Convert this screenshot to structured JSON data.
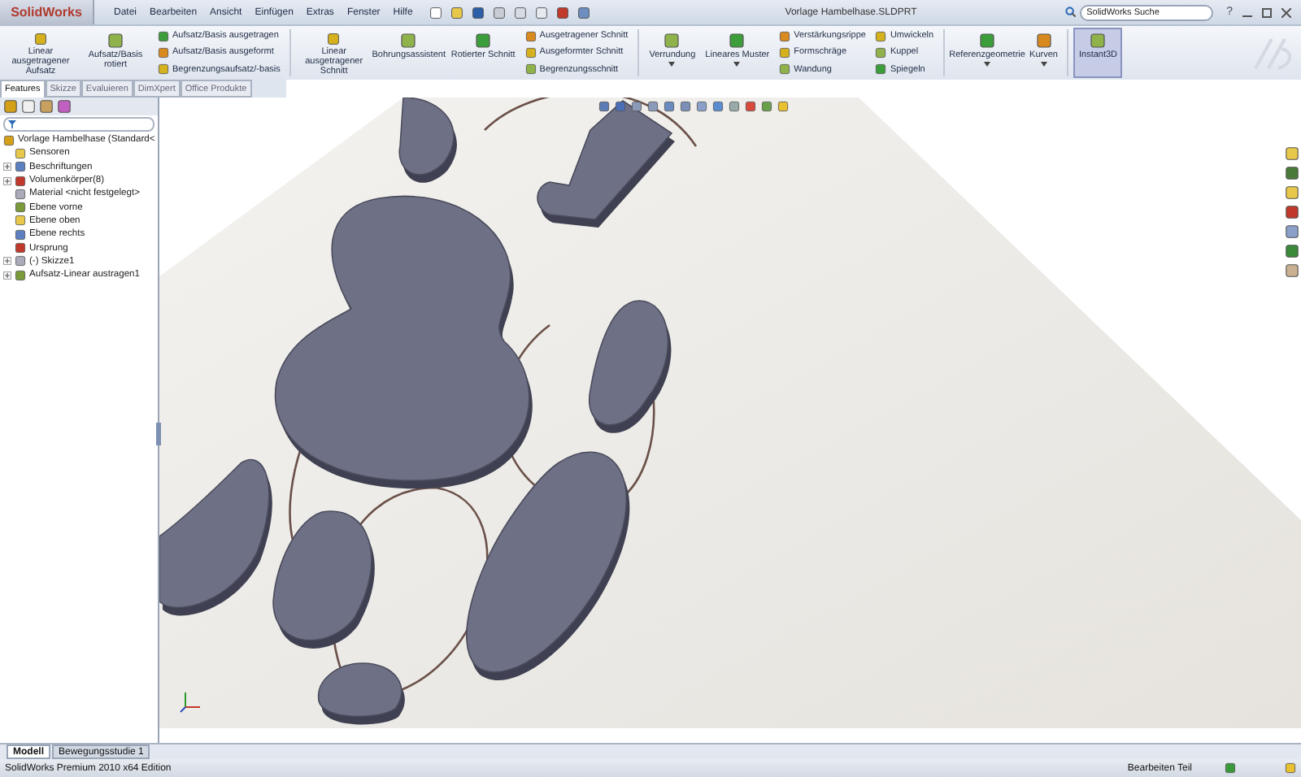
{
  "app": {
    "logo": "SolidWorks",
    "menu": [
      "Datei",
      "Bearbeiten",
      "Ansicht",
      "Einfügen",
      "Extras",
      "Fenster",
      "Hilfe"
    ],
    "document_title": "Vorlage Hambelhase.SLDPRT",
    "search": {
      "placeholder": "SolidWorks Suche"
    },
    "help": "?"
  },
  "ribbon": {
    "columns": [
      {
        "kind": "large",
        "label": "Linear ausgetragener Aufsatz",
        "dropdown": false,
        "selected": false
      },
      {
        "kind": "large",
        "label": "Aufsatz/Basis rotiert",
        "dropdown": false,
        "selected": false
      },
      {
        "kind": "stack",
        "items": [
          "Aufsatz/Basis ausgetragen",
          "Aufsatz/Basis ausgeformt",
          "Begrenzungsaufsatz/-basis"
        ]
      },
      {
        "kind": "separator"
      },
      {
        "kind": "large",
        "label": "Linear ausgetragener Schnitt",
        "dropdown": false,
        "selected": false
      },
      {
        "kind": "large",
        "label": "Bohrungsassistent",
        "dropdown": false,
        "selected": false
      },
      {
        "kind": "large",
        "label": "Rotierter Schnitt",
        "dropdown": false,
        "selected": false
      },
      {
        "kind": "stack",
        "items": [
          "Ausgetragener Schnitt",
          "Ausgeformter Schnitt",
          "Begrenzungsschnitt"
        ]
      },
      {
        "kind": "separator"
      },
      {
        "kind": "large",
        "label": "Verrundung",
        "dropdown": true,
        "selected": false
      },
      {
        "kind": "large",
        "label": "Lineares Muster",
        "dropdown": true,
        "selected": false
      },
      {
        "kind": "stack",
        "items": [
          "Verstärkungsrippe",
          "Formschräge",
          "Wandung"
        ]
      },
      {
        "kind": "stack",
        "items": [
          "Umwickeln",
          "Kuppel",
          "Spiegeln"
        ]
      },
      {
        "kind": "separator"
      },
      {
        "kind": "large",
        "label": "Referenzgeometrie",
        "dropdown": true,
        "selected": false
      },
      {
        "kind": "large",
        "label": "Kurven",
        "dropdown": true,
        "selected": false
      },
      {
        "kind": "separator"
      },
      {
        "kind": "large",
        "label": "Instant3D",
        "dropdown": false,
        "selected": true
      }
    ]
  },
  "command_tabs": [
    {
      "label": "Features",
      "selected": true
    },
    {
      "label": "Skizze",
      "selected": false
    },
    {
      "label": "Evaluieren",
      "selected": false
    },
    {
      "label": "DimXpert",
      "selected": false
    },
    {
      "label": "Office Produkte",
      "selected": false
    }
  ],
  "feature_tree": {
    "root": "Vorlage Hambelhase  (Standard<",
    "items": [
      {
        "label": "Sensoren",
        "kind": "leaf"
      },
      {
        "label": "Beschriftungen",
        "kind": "collapsed"
      },
      {
        "label": "Volumenkörper(8)",
        "kind": "collapsed"
      },
      {
        "label": "Material <nicht festgelegt>",
        "kind": "leaf"
      },
      {
        "label": "Ebene vorne",
        "kind": "leaf"
      },
      {
        "label": "Ebene oben",
        "kind": "leaf"
      },
      {
        "label": "Ebene rechts",
        "kind": "leaf"
      },
      {
        "label": "Ursprung",
        "kind": "leaf"
      },
      {
        "label": "(-) Skizze1",
        "kind": "collapsed"
      },
      {
        "label": "Aufsatz-Linear austragen1",
        "kind": "collapsed"
      }
    ]
  },
  "bottom_tabs": [
    {
      "label": "Modell",
      "selected": true
    },
    {
      "label": "Bewegungsstudie 1",
      "selected": false
    }
  ],
  "status_bar": {
    "edition": "SolidWorks Premium 2010 x64 Edition",
    "mode": "Bearbeiten Teil"
  }
}
